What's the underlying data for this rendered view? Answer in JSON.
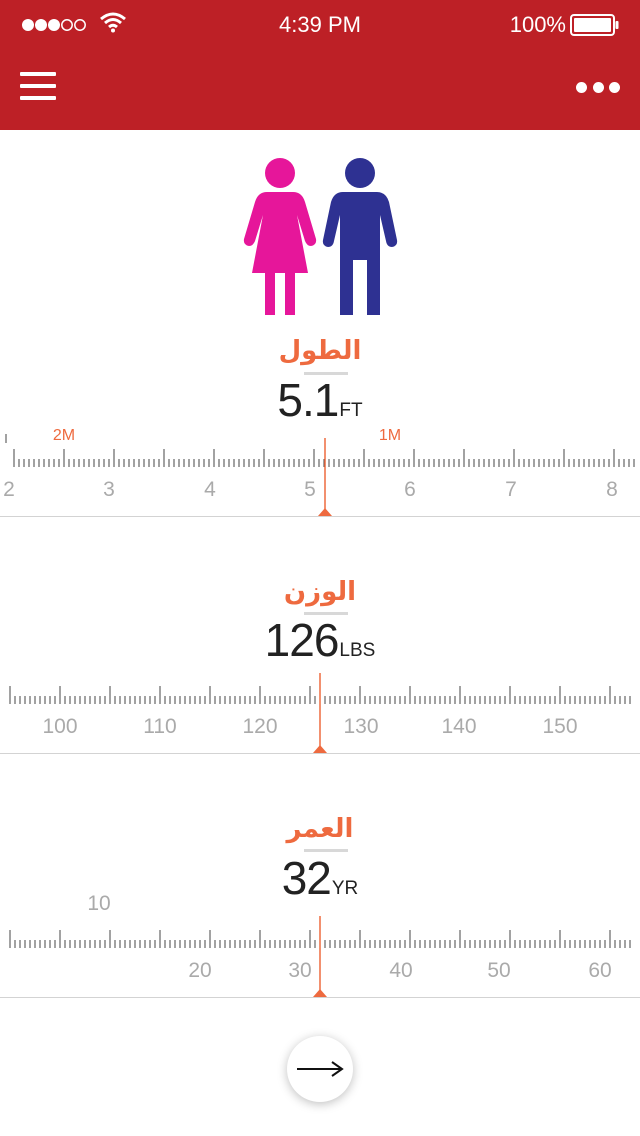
{
  "status_bar": {
    "time": "4:39 PM",
    "battery": "100%"
  },
  "colors": {
    "bar": "#bd2026",
    "accent": "#ee6a3f",
    "female": "#e6169a",
    "male": "#2e3192"
  },
  "icons": {
    "menu": "hamburger-icon",
    "more": "more-dots-icon",
    "female": "female-figure-icon",
    "male": "male-figure-icon",
    "next": "arrow-right-icon"
  },
  "height": {
    "label": "الطول",
    "value": "5.1",
    "unit": "FT",
    "scale_labels": [
      "2",
      "3",
      "4",
      "5",
      "6",
      "7",
      "8"
    ],
    "metric_labels": [
      "2M",
      "1M"
    ]
  },
  "weight": {
    "label": "الوزن",
    "value": "126",
    "unit": "LBS",
    "scale_labels": [
      "100",
      "110",
      "120",
      "130",
      "140",
      "150"
    ]
  },
  "age": {
    "label": "العمر",
    "value": "32",
    "unit": "YR",
    "scale_labels": [
      "10",
      "20",
      "30",
      "40",
      "50",
      "60"
    ]
  }
}
